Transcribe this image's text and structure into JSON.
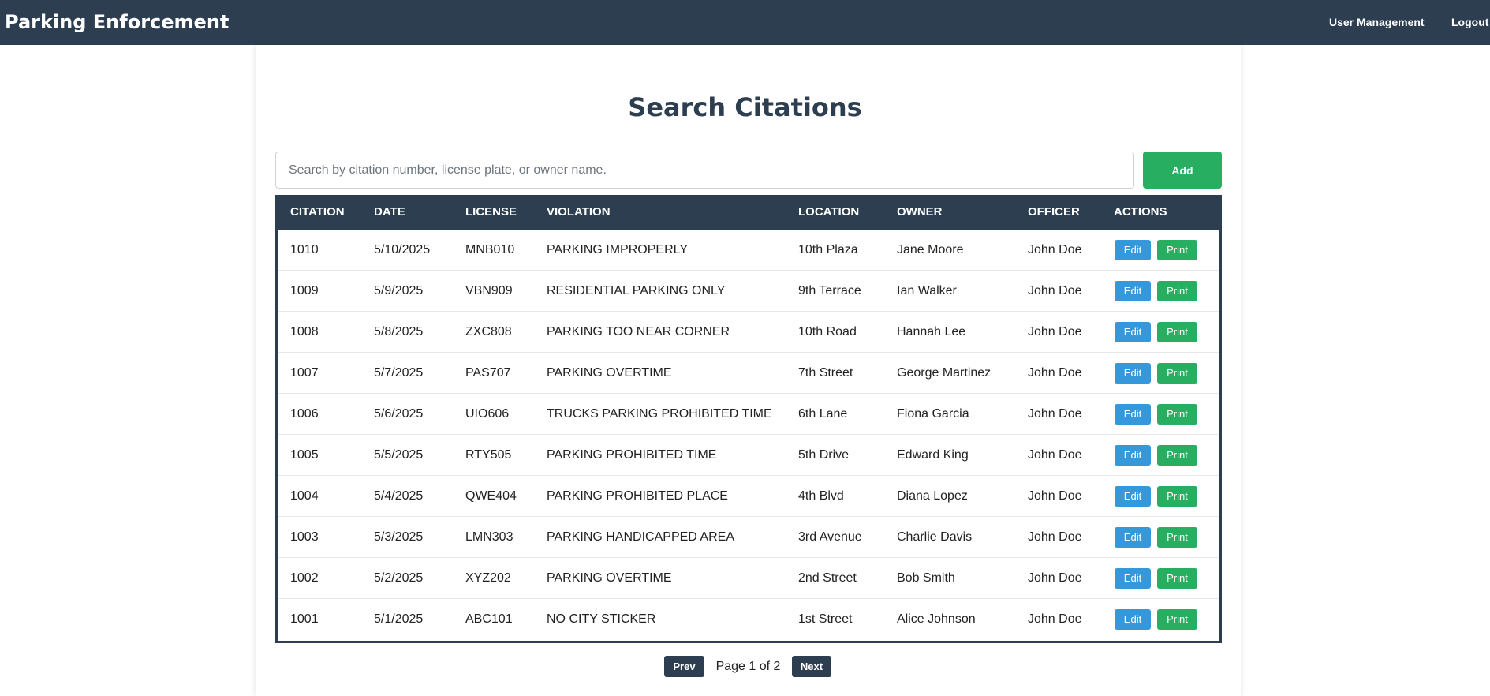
{
  "header": {
    "title": "Parking Enforcement",
    "nav": [
      "User Management",
      "Logout"
    ]
  },
  "main": {
    "title": "Search Citations",
    "search": {
      "placeholder": "Search by citation number, license plate, or owner name.",
      "value": ""
    },
    "add_label": "Add"
  },
  "table": {
    "columns": [
      "CITATION",
      "DATE",
      "LICENSE",
      "VIOLATION",
      "LOCATION",
      "OWNER",
      "OFFICER",
      "ACTIONS"
    ],
    "rows": [
      {
        "citation": "1010",
        "date": "5/10/2025",
        "license": "MNB010",
        "violation": "PARKING IMPROPERLY",
        "location": "10th Plaza",
        "owner": "Jane Moore",
        "officer": "John Doe"
      },
      {
        "citation": "1009",
        "date": "5/9/2025",
        "license": "VBN909",
        "violation": "RESIDENTIAL PARKING ONLY",
        "location": "9th Terrace",
        "owner": "Ian Walker",
        "officer": "John Doe"
      },
      {
        "citation": "1008",
        "date": "5/8/2025",
        "license": "ZXC808",
        "violation": "PARKING TOO NEAR CORNER",
        "location": "10th Road",
        "owner": "Hannah Lee",
        "officer": "John Doe"
      },
      {
        "citation": "1007",
        "date": "5/7/2025",
        "license": "PAS707",
        "violation": "PARKING OVERTIME",
        "location": "7th Street",
        "owner": "George Martinez",
        "officer": "John Doe"
      },
      {
        "citation": "1006",
        "date": "5/6/2025",
        "license": "UIO606",
        "violation": "TRUCKS PARKING PROHIBITED TIME",
        "location": "6th Lane",
        "owner": "Fiona Garcia",
        "officer": "John Doe"
      },
      {
        "citation": "1005",
        "date": "5/5/2025",
        "license": "RTY505",
        "violation": "PARKING PROHIBITED TIME",
        "location": "5th Drive",
        "owner": "Edward King",
        "officer": "John Doe"
      },
      {
        "citation": "1004",
        "date": "5/4/2025",
        "license": "QWE404",
        "violation": "PARKING PROHIBITED PLACE",
        "location": "4th Blvd",
        "owner": "Diana Lopez",
        "officer": "John Doe"
      },
      {
        "citation": "1003",
        "date": "5/3/2025",
        "license": "LMN303",
        "violation": "PARKING HANDICAPPED AREA",
        "location": "3rd Avenue",
        "owner": "Charlie Davis",
        "officer": "John Doe"
      },
      {
        "citation": "1002",
        "date": "5/2/2025",
        "license": "XYZ202",
        "violation": "PARKING OVERTIME",
        "location": "2nd Street",
        "owner": "Bob Smith",
        "officer": "John Doe"
      },
      {
        "citation": "1001",
        "date": "5/1/2025",
        "license": "ABC101",
        "violation": "NO CITY STICKER",
        "location": "1st Street",
        "owner": "Alice Johnson",
        "officer": "John Doe"
      }
    ],
    "edit_label": "Edit",
    "print_label": "Print"
  },
  "pagination": {
    "prev_label": "Prev",
    "page_text": "Page 1 of 2",
    "next_label": "Next"
  },
  "colors": {
    "header_bg": "#2c3e50",
    "accent_green": "#27ae60",
    "accent_blue": "#3498db"
  }
}
